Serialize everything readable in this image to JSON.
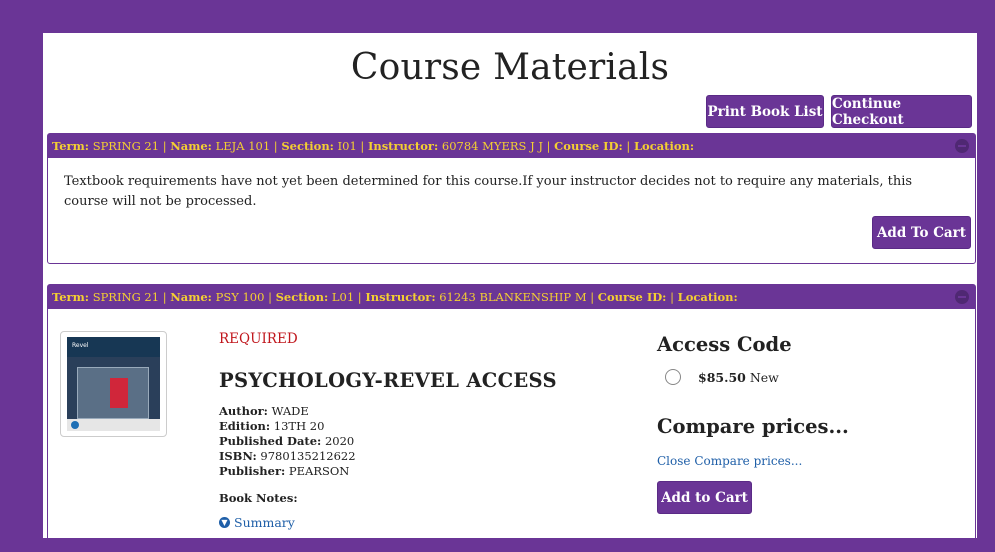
{
  "page_title": "Course Materials",
  "buttons": {
    "print_book_list": "Print Book List",
    "continue_checkout": "Continue Checkout"
  },
  "courses": [
    {
      "header": {
        "term_label": "Term:",
        "term": "SPRING 21",
        "name_label": "Name:",
        "name": "LEJA 101",
        "section_label": "Section:",
        "section": "I01",
        "instructor_label": "Instructor:",
        "instructor": "60784 MYERS J J",
        "course_id_label": "Course ID:",
        "course_id": "",
        "location_label": "Location:",
        "location": ""
      },
      "message": "Textbook requirements have not yet been determined for this course.If your instructor decides not to require any materials, this course will not be processed.",
      "add_to_cart": "Add To Cart"
    },
    {
      "header": {
        "term_label": "Term:",
        "term": "SPRING 21",
        "name_label": "Name:",
        "name": "PSY 100",
        "section_label": "Section:",
        "section": "L01",
        "instructor_label": "Instructor:",
        "instructor": "61243 BLANKENSHIP M",
        "course_id_label": "Course ID:",
        "course_id": "",
        "location_label": "Location:",
        "location": ""
      },
      "book": {
        "cover_brand": "Revel",
        "required_label": "REQUIRED",
        "title": "PSYCHOLOGY-REVEL ACCESS",
        "author_label": "Author:",
        "author": "WADE",
        "edition_label": "Edition:",
        "edition": "13TH 20",
        "published_label": "Published Date:",
        "published": "2020",
        "isbn_label": "ISBN:",
        "isbn": "9780135212622",
        "publisher_label": "Publisher:",
        "publisher": "PEARSON",
        "notes_label": "Book Notes:",
        "summary_label": "Summary"
      },
      "purchase": {
        "access_code_title": "Access Code",
        "price": "$85.50",
        "condition": "New",
        "compare_title": "Compare prices...",
        "close_compare": "Close Compare prices...",
        "add_to_cart": "Add to Cart"
      }
    }
  ],
  "colors": {
    "brand_purple": "#6a3596",
    "header_text_gold": "#f4cf32",
    "required_red": "#c0161c",
    "link_blue": "#1f5fa8"
  }
}
